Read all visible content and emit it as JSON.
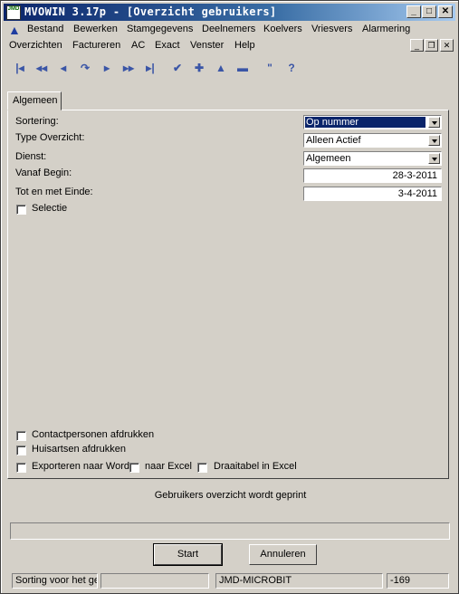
{
  "window": {
    "title": "MVOWIN 3.17p - [Overzicht gebruikers]",
    "app_icon_text": "JMD"
  },
  "menu": {
    "row1": [
      "Bestand",
      "Bewerken",
      "Stamgegevens",
      "Deelnemers",
      "Koelvers",
      "Vriesvers",
      "Alarmering"
    ],
    "row2": [
      "Overzichten",
      "Factureren",
      "AC",
      "Exact",
      "Venster",
      "Help"
    ]
  },
  "toolbar_icons": [
    "first-icon",
    "prev-page-icon",
    "prev-icon",
    "refresh-icon",
    "next-icon",
    "next-page-icon",
    "last-icon",
    "check-icon",
    "add-icon",
    "up-icon",
    "delete-icon",
    "quote-icon",
    "help-icon"
  ],
  "tab": {
    "label": "Algemeen"
  },
  "form": {
    "sortering_label": "Sortering:",
    "sortering_value": "Op nummer",
    "type_label": "Type Overzicht:",
    "type_value": "Alleen Actief",
    "dienst_label": "Dienst:",
    "dienst_value": "Algemeen",
    "vanaf_label": "Vanaf Begin:",
    "vanaf_value": "28-3-2011",
    "tot_label": "Tot en met Einde:",
    "tot_value": "3-4-2011",
    "selectie_label": "Selectie",
    "contactpersonen_label": "Contactpersonen afdrukken",
    "huisartsen_label": "Huisartsen afdrukken",
    "exporteren_label": "Exporteren naar Word",
    "excel_label": "naar Excel",
    "draaitabel_label": "Draaitabel in Excel"
  },
  "status_message": "Gebruikers overzicht wordt geprint",
  "progress": 0,
  "buttons": {
    "start": "Start",
    "cancel": "Annuleren"
  },
  "statusbar": {
    "hint": "Sorting voor het ge",
    "company": "JMD-MICROBIT",
    "code": "-169"
  },
  "colors": {
    "title_start": "#0a246a",
    "selection": "#0a246a",
    "icon_blue": "#3a55a6"
  }
}
